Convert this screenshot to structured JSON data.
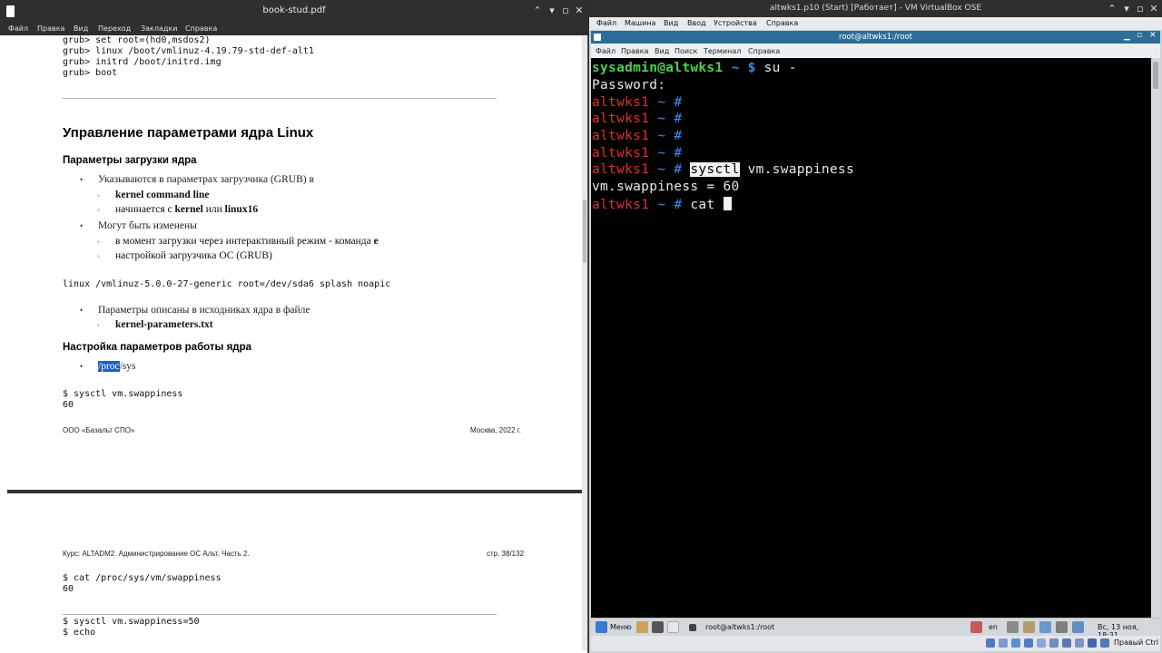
{
  "pdf": {
    "title": "book-stud.pdf",
    "menu": [
      "Файл",
      "Правка",
      "Вид",
      "Переход",
      "Закладки",
      "Справка"
    ],
    "page1": {
      "grub_lines": [
        "grub> set root=(hd0,msdos2)",
        "grub> linux /boot/vmlinuz-4.19.79-std-def-alt1",
        "grub> initrd /boot/initrd.img",
        "grub> boot"
      ],
      "heading": "Управление параметрами ядра Linux",
      "section1_title": "Параметры загрузки ядра",
      "b1": "Указываются в параметрах загрузчика (GRUB) в",
      "b1_sub1": "kernel command line",
      "b1_sub2_pre": "начинается с ",
      "b1_sub2_kernel": "kernel",
      "b1_sub2_or": " или ",
      "b1_sub2_linux16": "linux16",
      "b2": "Могут быть изменены",
      "b2_sub1_pre": "в момент загрузки через интерактивный режим - команда ",
      "b2_sub1_e": "e",
      "b2_sub2": "настройкой загрузчика ОС (GRUB)",
      "kernel_cmdline": "linux /vmlinuz-5.0.0-27-generic root=/dev/sda6 splash noapic",
      "b3": "Параметры описаны в исходниках ядра в файле",
      "b3_sub1": "kernel-parameters.txt",
      "section2_title": "Настройка параметров работы ядра",
      "b4_hl": "/proc",
      "b4_rest": "/sys",
      "sysctl_cmd": "$ sysctl vm.swappiness",
      "sysctl_out": "60",
      "footer_left": "ООО «Базальт СПО»",
      "footer_right": "Москва, 2022 г."
    },
    "page2": {
      "header_left": "Курс: ALTADM2. Администрирование ОС Альт. Часть 2.",
      "header_right": "стр. 38/132",
      "cat_cmd": "$ cat /proc/sys/vm/swappiness",
      "cat_out": "60",
      "set_cmd": "$ sysctl vm.swappiness=50",
      "echo_cmd": "$ echo"
    }
  },
  "vbox": {
    "title": "altwks1.p10 (Start) [Работает] - VM VirtualBox OSE",
    "menu": [
      "Файл",
      "Машина",
      "Вид",
      "Ввод",
      "Устройства",
      "Справка"
    ],
    "host_key": "Правый Ctrl"
  },
  "terminal": {
    "title": "root@altwks1:/root",
    "menu": [
      "Файл",
      "Правка",
      "Вид",
      "Поиск",
      "Терминал",
      "Справка"
    ],
    "user_prompt_user": "sysadmin@altwks1",
    "user_prompt_rest": " ~ $ ",
    "su_cmd": "su -",
    "password_line": "Password:",
    "root_host": "altwks1",
    "root_tilde": " ~ ",
    "root_hash": "#",
    "cmd_sysctl": "sysctl",
    "cmd_sysctl_arg": " vm.swappiness",
    "sysctl_output": "vm.swappiness = 60",
    "cmd_cat": "cat "
  },
  "guest_taskbar": {
    "menu_label": "Меню",
    "window_task": "root@altwks1:/root",
    "lang": "en",
    "clock": "Вс, 13 ноя, 18:31"
  }
}
